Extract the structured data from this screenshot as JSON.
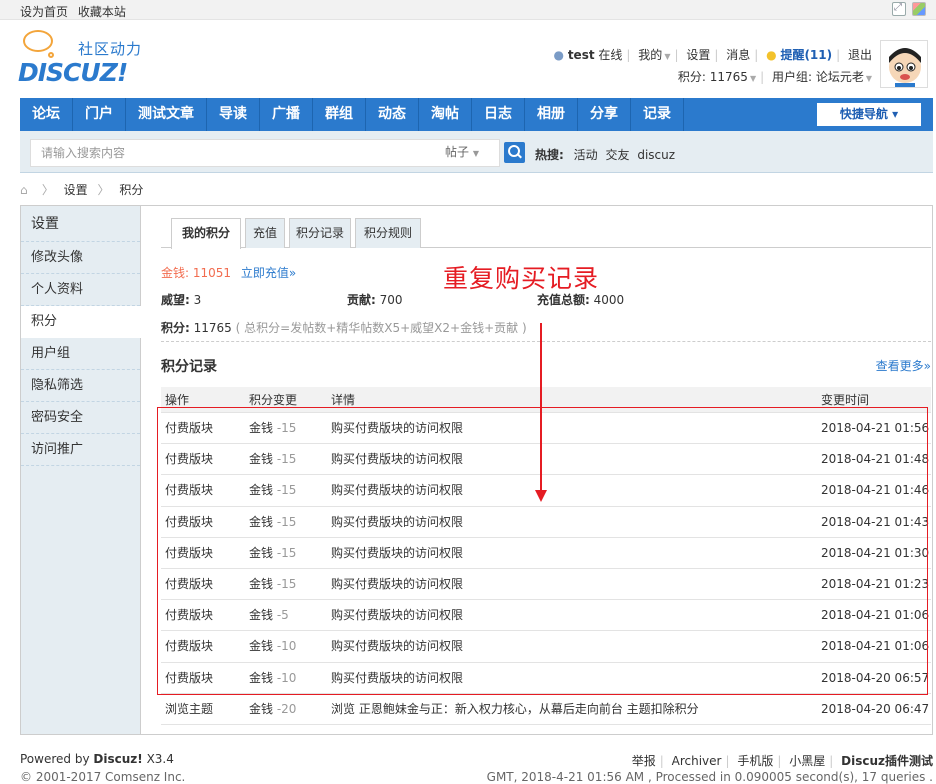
{
  "topbar": {
    "set_home": "设为首页",
    "bookmark": "收藏本站"
  },
  "logo": {
    "cn_text": "社区动力",
    "name": "DISCUZ!"
  },
  "user": {
    "username": "test",
    "online": "在线",
    "mine": "我的",
    "settings": "设置",
    "messages": "消息",
    "remind": "提醒(11)",
    "logout": "退出",
    "credits": "积分: 11765",
    "usergroup": "用户组: 论坛元老"
  },
  "nav": {
    "items": [
      "论坛",
      "门户",
      "测试文章",
      "导读",
      "广播",
      "群组",
      "动态",
      "淘帖",
      "日志",
      "相册",
      "分享",
      "记录"
    ],
    "quick": "快捷导航"
  },
  "search": {
    "placeholder": "请输入搜索内容",
    "type": "帖子",
    "hot_label": "热搜:",
    "hot": [
      "活动",
      "交友",
      "discuz"
    ]
  },
  "breadcrumb": {
    "items": [
      "设置",
      "积分"
    ]
  },
  "sidebar": {
    "title": "设置",
    "items": [
      "修改头像",
      "个人资料",
      "积分",
      "用户组",
      "隐私筛选",
      "密码安全",
      "访问推广"
    ]
  },
  "tabs": [
    "我的积分",
    "充值",
    "积分记录",
    "积分规则"
  ],
  "credits": {
    "gold_label": "金钱:",
    "gold_value": "11051",
    "recharge_link": "立即充值»",
    "prestige": "威望:",
    "prestige_value": "3",
    "contribution": "贡献:",
    "contribution_value": "700",
    "recharge_total": "充值总额:",
    "recharge_total_value": "4000",
    "total_label": "积分:",
    "total_value": "11765",
    "formula": "( 总积分=发帖数+精华帖数X5+威望X2+金钱+贡献 )"
  },
  "annotation": "重复购买记录",
  "records": {
    "title": "积分记录",
    "more": "查看更多»",
    "headers": [
      "操作",
      "积分变更",
      "详情",
      "变更时间"
    ],
    "rows": [
      {
        "op": "付费版块",
        "type": "金钱",
        "amount": "-15",
        "detail": "购买付费版块的访问权限",
        "time": "2018-04-21 01:56"
      },
      {
        "op": "付费版块",
        "type": "金钱",
        "amount": "-15",
        "detail": "购买付费版块的访问权限",
        "time": "2018-04-21 01:48"
      },
      {
        "op": "付费版块",
        "type": "金钱",
        "amount": "-15",
        "detail": "购买付费版块的访问权限",
        "time": "2018-04-21 01:46"
      },
      {
        "op": "付费版块",
        "type": "金钱",
        "amount": "-15",
        "detail": "购买付费版块的访问权限",
        "time": "2018-04-21 01:43"
      },
      {
        "op": "付费版块",
        "type": "金钱",
        "amount": "-15",
        "detail": "购买付费版块的访问权限",
        "time": "2018-04-21 01:30"
      },
      {
        "op": "付费版块",
        "type": "金钱",
        "amount": "-15",
        "detail": "购买付费版块的访问权限",
        "time": "2018-04-21 01:23"
      },
      {
        "op": "付费版块",
        "type": "金钱",
        "amount": "-5",
        "detail": "购买付费版块的访问权限",
        "time": "2018-04-21 01:06"
      },
      {
        "op": "付费版块",
        "type": "金钱",
        "amount": "-10",
        "detail": "购买付费版块的访问权限",
        "time": "2018-04-21 01:06"
      },
      {
        "op": "付费版块",
        "type": "金钱",
        "amount": "-10",
        "detail": "购买付费版块的访问权限",
        "time": "2018-04-20 06:57"
      },
      {
        "op": "浏览主题",
        "type": "金钱",
        "amount": "-20",
        "detail": "浏览 正恩鲍妹金与正：新入权力核心，从幕后走向前台 主题扣除积分",
        "time": "2018-04-20 06:47"
      }
    ]
  },
  "footer": {
    "powered_prefix": "Powered by",
    "powered_name": "Discuz!",
    "version": "X3.4",
    "copyright": "© 2001-2017 Comsenz Inc.",
    "links": [
      "举报",
      "Archiver",
      "手机版",
      "小黑屋"
    ],
    "site": "Discuz插件测试",
    "gmt": "GMT, 2018-4-21 01:56 AM , Processed in 0.090005 second(s), 17 queries ."
  },
  "colors": {
    "brand": "#2b7acd",
    "gold": "#f26c4f",
    "annotation": "#e51c23",
    "side_bg": "#e5edf2"
  }
}
